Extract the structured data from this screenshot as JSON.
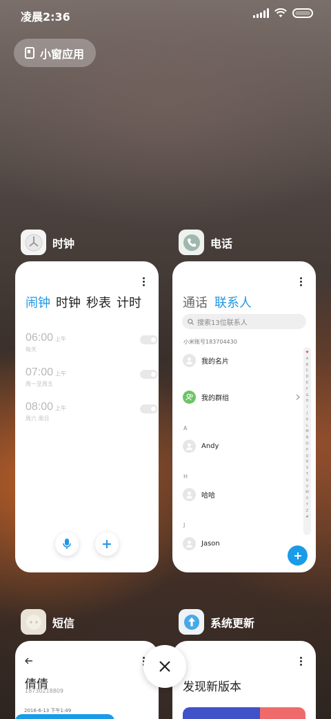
{
  "status_bar": {
    "time": "凌晨2:36"
  },
  "floating_window": {
    "label": "小窗应用"
  },
  "cards": {
    "clock": {
      "title": "时钟",
      "tabs": [
        "闹钟",
        "时钟",
        "秒表",
        "计时"
      ],
      "alarms": [
        {
          "time": "06:00",
          "ampm": "上午",
          "repeat": "每天"
        },
        {
          "time": "07:00",
          "ampm": "上午",
          "repeat": "周一至周五"
        },
        {
          "time": "08:00",
          "ampm": "上午",
          "repeat": "周六 周日"
        }
      ]
    },
    "phone": {
      "title": "电话",
      "tabs": [
        "通话",
        "联系人"
      ],
      "search_placeholder": "搜索13位联系人",
      "account": "小米账号183704430",
      "contacts": {
        "my_card": "我的名片",
        "my_groups": "我的群组",
        "andy": "Andy",
        "haha": "哈哈",
        "jason": "Jason"
      },
      "sections": {
        "a": "A",
        "h": "H",
        "j": "J"
      },
      "index_letters": "♥ A B C D E F G H I J K L M N O P Q R S T U V W X Y Z #"
    },
    "sms": {
      "title": "短信",
      "contact_name": "倩倩",
      "contact_number": "18730218809",
      "date": "2016-6-13 下午1:49"
    },
    "update": {
      "title": "系统更新",
      "heading": "发现新版本"
    }
  },
  "colors": {
    "accent": "#2196e6",
    "fab": "#1a9be8",
    "card": "#ffffff"
  }
}
